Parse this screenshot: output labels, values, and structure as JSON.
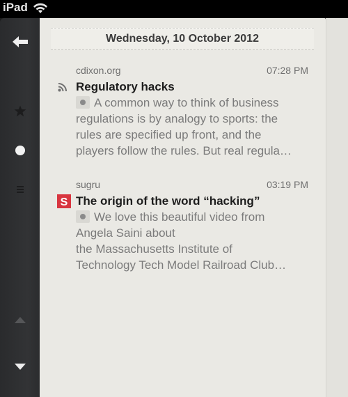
{
  "statusbar": {
    "device": "iPad",
    "wifi_icon": "wifi-icon"
  },
  "sidebar": {
    "back_icon": "arrow-left-icon",
    "star_icon": "star-icon",
    "unread_icon": "circle-icon",
    "list_icon": "list-icon",
    "prev_icon": "arrow-up-icon",
    "next_icon": "arrow-down-icon"
  },
  "header": {
    "date": "Wednesday, 10 October 2012"
  },
  "articles": [
    {
      "source": "cdixon.org",
      "time": "07:28 PM",
      "icon": "rss-icon",
      "title": "Regulatory hacks",
      "excerpt_lines": [
        "A common way to think of business",
        "regulations is by analogy to sports: the",
        "rules are specified up front, and the",
        "players follow the rules. But real regula…"
      ]
    },
    {
      "source": "sugru",
      "time": "03:19 PM",
      "icon": "sugru-logo-icon",
      "icon_letter": "S",
      "title": "The origin of the word “hacking”",
      "excerpt_lines": [
        "We love this beautiful video from",
        "Angela Saini about",
        "the Massachusetts Institute of",
        "Technology Tech Model Railroad Club…"
      ]
    }
  ],
  "colors": {
    "sugru_brand": "#d8353f",
    "sidebar_bg": "#2f3032",
    "paper_bg": "#eae9e4"
  }
}
